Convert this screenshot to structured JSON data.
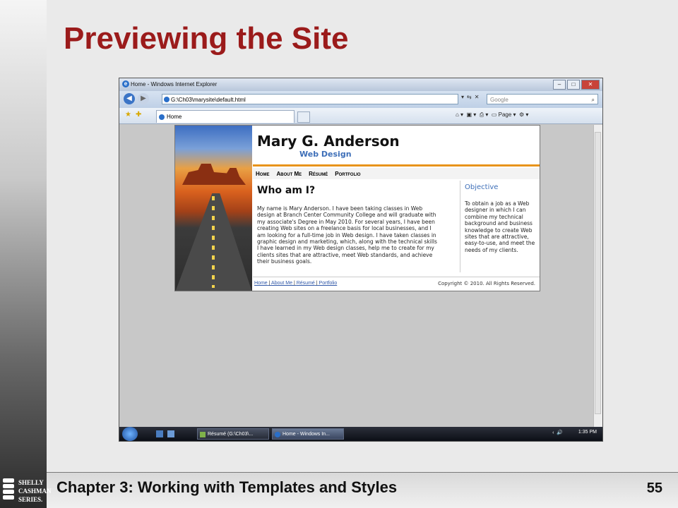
{
  "slide": {
    "title": "Previewing the Site",
    "footer": "Chapter 3: Working with Templates and Styles",
    "page_number": "55",
    "logo_lines": [
      "SHELLY",
      "CASHMAN",
      "SERIES."
    ]
  },
  "browser": {
    "window_title": "Home - Windows Internet Explorer",
    "address": "G:\\Ch03\\marysite\\default.html",
    "search_placeholder": "Google",
    "tab_label": "Home",
    "page_menu": "Page",
    "taskbar": {
      "items": [
        "Résumé (G:\\Ch03\\...",
        "Home - Windows In..."
      ],
      "clock": "1:35 PM"
    }
  },
  "website": {
    "name": "Mary G. Anderson",
    "subtitle": "Web Design",
    "nav": [
      "Home",
      "About Me",
      "Résumé",
      "Portfolio"
    ],
    "heading": "Who am I?",
    "bio": "My name is Mary Anderson. I have been taking classes in Web design at Branch Center Community College and will graduate with my associate's Degree in May 2010. For several years, I have been creating Web sites on a freelance basis for local businesses, and I am looking for a full-time job in Web design. I have taken classes in graphic design and marketing, which, along with the technical skills I have learned in my Web design classes, help me to create for my clients sites that are attractive, meet Web standards, and achieve their business goals.",
    "objective_heading": "Objective",
    "objective_text": "To obtain a job as a Web designer in which I can combine my technical background and business knowledge to create Web sites that are attractive, easy-to-use, and meet the needs of my clients.",
    "footer_links": [
      "Home",
      "About Me",
      "Résumé",
      "Portfolio"
    ],
    "copyright": "Copyright © 2010. All Rights Reserved."
  },
  "colors": {
    "title": "#9b1b1b",
    "accent_orange": "#e8941b",
    "link_blue": "#3e6fb8"
  }
}
